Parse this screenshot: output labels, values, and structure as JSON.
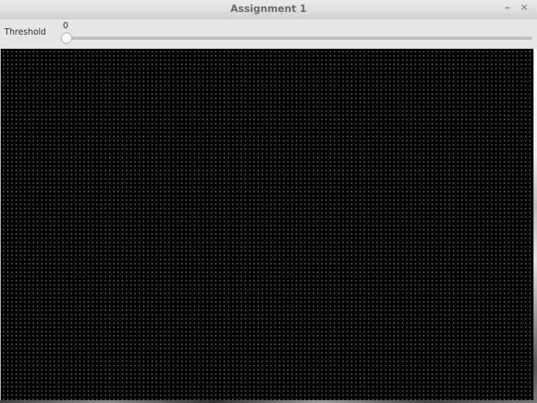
{
  "window": {
    "title": "Assignment 1",
    "minimize_glyph": "–",
    "close_glyph": "✕"
  },
  "trackbar": {
    "label": "Threshold",
    "value": "0",
    "min": 0,
    "position_fraction": 0
  },
  "image": {
    "description_icon": "image-canvas",
    "background_color": "#000000",
    "dot_color": "#c8c8c8"
  }
}
